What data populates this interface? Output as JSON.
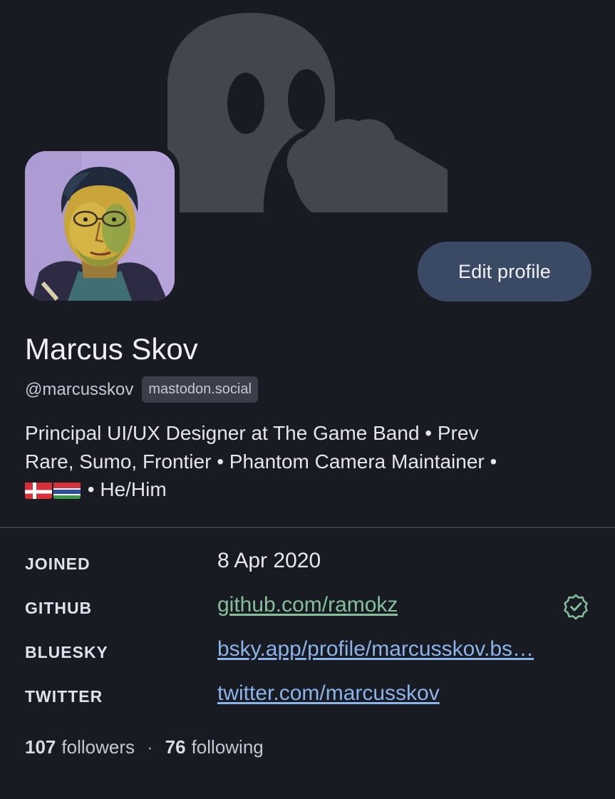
{
  "profile": {
    "edit_button": "Edit profile",
    "display_name": "Marcus Skov",
    "handle": "@marcusskov",
    "server": "mastodon.social",
    "bio_line1": "Principal UI/UX Designer at The Game Band • Prev",
    "bio_line2": "Rare, Sumo, Frontier • Phantom Camera Maintainer •",
    "bio_line3_suffix": " • He/Him",
    "bio_flags": [
      "denmark-flag",
      "gambia-flag"
    ]
  },
  "fields": [
    {
      "label": "JOINED",
      "value": "8 Apr 2020",
      "type": "text"
    },
    {
      "label": "GITHUB",
      "value": "github.com/ramokz",
      "type": "verified"
    },
    {
      "label": "BLUESKY",
      "value": "bsky.app/profile/marcusskov.bs…",
      "type": "link"
    },
    {
      "label": "TWITTER",
      "value": "twitter.com/marcusskov",
      "type": "link"
    }
  ],
  "stats": {
    "followers_count": "107",
    "followers_label": "followers",
    "separator": "·",
    "following_count": "76",
    "following_label": "following"
  },
  "colors": {
    "background": "#191b22",
    "button": "#3b4a64",
    "verified": "#86c09a",
    "link": "#8ab4ea",
    "badge": "#3a3f4b"
  },
  "icons": {
    "banner": "mastodon-mascot-icon",
    "verified": "verified-check-icon"
  }
}
